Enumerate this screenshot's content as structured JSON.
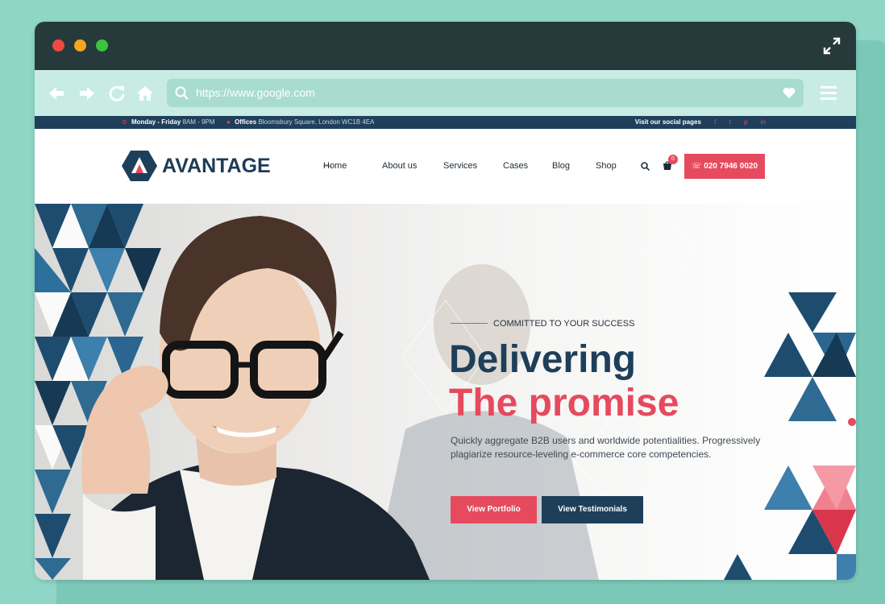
{
  "browser": {
    "url": "https://www.google.com"
  },
  "topbar": {
    "hours_label": "Monday - Friday",
    "hours_value": "8AM - 9PM",
    "offices_label": "Offices",
    "offices_value": "Bloomsbury Square, London WC1B 4EA",
    "social_label": "Visit our social pages",
    "social": [
      "f",
      "t",
      "p",
      "in"
    ]
  },
  "header": {
    "logo_text": "AVANTAGE",
    "menu": [
      "Home",
      "About us",
      "Services",
      "Cases",
      "Blog",
      "Shop"
    ],
    "cart_count": "0",
    "phone": "020 7946 0020"
  },
  "hero": {
    "tagline": "COMMITTED TO YOUR SUCCESS",
    "headline1": "Delivering",
    "headline2": "The promise",
    "lead": "Quickly aggregate B2B users and worldwide potentialities. Progressively plagiarize resource-leveling e-commerce core competencies.",
    "btn_portfolio": "View Portfolio",
    "btn_testimonials": "View Testimonials"
  },
  "colors": {
    "accent": "#e64a5e",
    "navy": "#1e3f5a",
    "frame": "#263a3b",
    "mint": "#c8ece3"
  }
}
